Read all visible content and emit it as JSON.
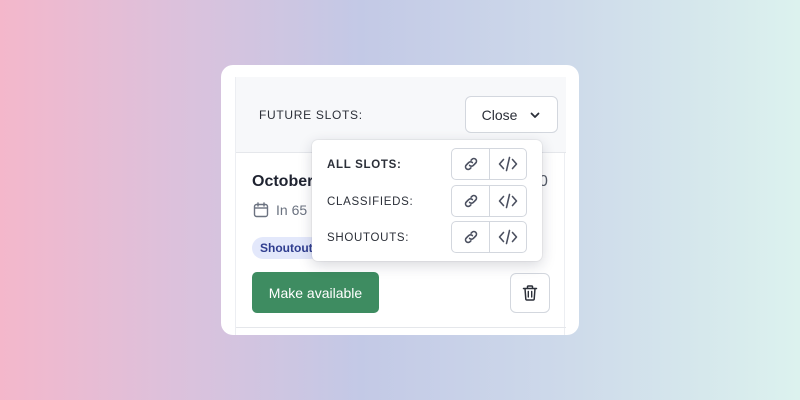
{
  "header": {
    "label": "FUTURE SLOTS:",
    "close_label": "Close"
  },
  "slot": {
    "title": "October",
    "title_right": "0",
    "meta": "In 65",
    "tag": "Shoutout",
    "make_available_label": "Make available"
  },
  "dropdown": {
    "items": [
      {
        "label": "ALL SLOTS:"
      },
      {
        "label": "CLASSIFIEDS:"
      },
      {
        "label": "SHOUTOUTS:"
      }
    ]
  },
  "icons": {
    "chevron": "chevron-down-icon",
    "calendar": "calendar-icon",
    "trash": "trash-icon",
    "link": "link-icon",
    "code": "code-icon"
  },
  "colors": {
    "primary_button": "#3e8c61",
    "tag_bg": "#e3e8fb",
    "tag_text": "#2f3d8f"
  }
}
